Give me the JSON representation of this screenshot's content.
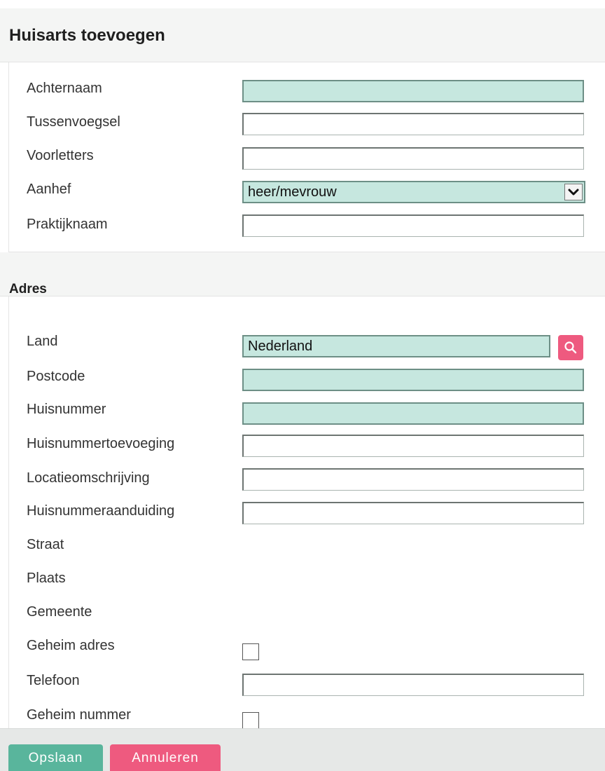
{
  "form": {
    "title": "Huisarts toevoegen"
  },
  "doctor": {
    "achternaam_label": "Achternaam",
    "achternaam_value": "",
    "tussenvoegsel_label": "Tussenvoegsel",
    "tussenvoegsel_value": "",
    "voorletters_label": "Voorletters",
    "voorletters_value": "",
    "aanhef_label": "Aanhef",
    "aanhef_value": "heer/mevrouw",
    "praktijknaam_label": "Praktijknaam",
    "praktijknaam_value": ""
  },
  "address": {
    "title": "Adres",
    "land_label": "Land",
    "land_value": "Nederland",
    "postcode_label": "Postcode",
    "postcode_value": "",
    "huisnummer_label": "Huisnummer",
    "huisnummer_value": "",
    "huisnummertoevoeging_label": "Huisnummertoevoeging",
    "huisnummertoevoeging_value": "",
    "locatieomschrijving_label": "Locatieomschrijving",
    "locatieomschrijving_value": "",
    "huisnummeraanduiding_label": "Huisnummeraanduiding",
    "huisnummeraanduiding_value": "",
    "straat_label": "Straat",
    "plaats_label": "Plaats",
    "gemeente_label": "Gemeente",
    "geheim_adres_label": "Geheim adres",
    "geheim_adres_checked": false,
    "telefoon_label": "Telefoon",
    "telefoon_value": "",
    "geheim_nummer_label": "Geheim nummer",
    "geheim_nummer_checked": false
  },
  "actions": {
    "save_label": "Opslaan",
    "cancel_label": "Annuleren"
  },
  "colors": {
    "required_field": "#c6e7df",
    "save_button": "#59b59c",
    "cancel_button": "#ee5a7f",
    "search_button": "#ee5a7f"
  },
  "icons": {
    "search": "search-icon",
    "dropdown": "chevron-down-icon"
  }
}
